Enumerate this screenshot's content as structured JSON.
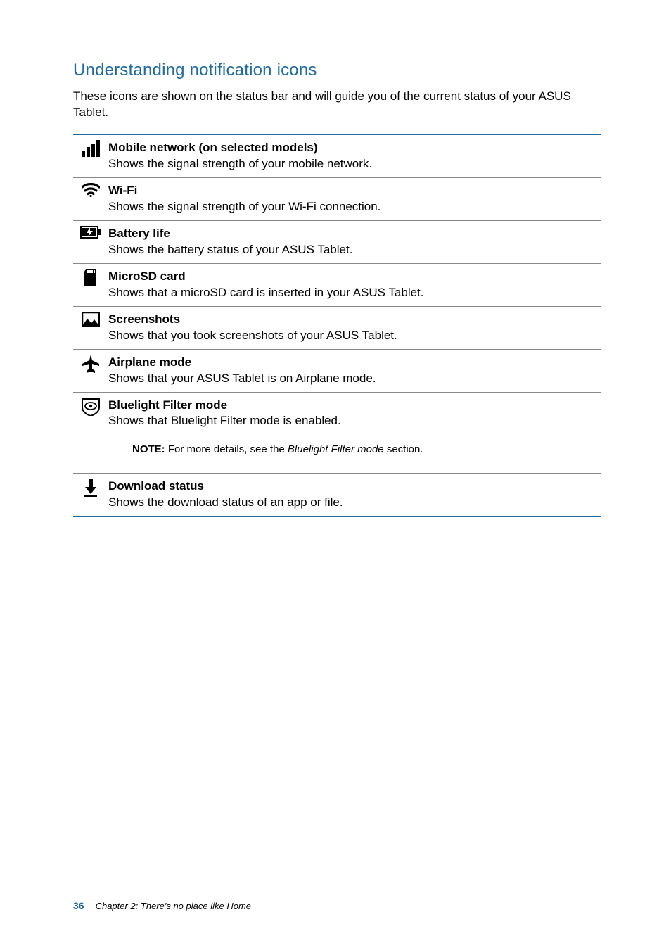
{
  "heading": "Understanding notification icons",
  "intro": "These icons are shown on the status bar and will guide you of the current status of your ASUS Tablet.",
  "rows": [
    {
      "title": "Mobile network (on selected models)",
      "desc": "Shows the signal strength of your mobile network."
    },
    {
      "title": "Wi-Fi",
      "desc": "Shows the signal strength of your Wi-Fi connection."
    },
    {
      "title": "Battery life",
      "desc": "Shows the battery status of your ASUS Tablet."
    },
    {
      "title": "MicroSD card",
      "desc": "Shows that a microSD card is inserted in your ASUS Tablet."
    },
    {
      "title": "Screenshots",
      "desc": "Shows that you took screenshots of your ASUS Tablet."
    },
    {
      "title": "Airplane mode",
      "desc": "Shows that your ASUS Tablet is on Airplane mode."
    },
    {
      "title": "Bluelight Filter mode",
      "desc": "Shows that Bluelight Filter mode is enabled.",
      "note_label": "NOTE:",
      "note_pre": " For more details, see the ",
      "note_italic": "Bluelight Filter mode",
      "note_post": " section."
    },
    {
      "title": "Download status",
      "desc": "Shows the download status of an app or file."
    }
  ],
  "footer": {
    "page": "36",
    "chapter": "Chapter 2: There's no place like Home"
  }
}
